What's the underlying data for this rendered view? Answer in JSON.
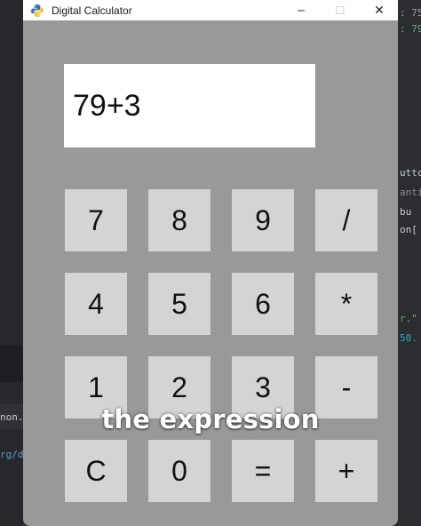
{
  "window": {
    "title": "Digital Calculator",
    "minimize_glyph": "─",
    "maximize_glyph": "☐",
    "close_glyph": "✕",
    "icon": "python-icon"
  },
  "display": {
    "value": "79+3"
  },
  "keypad": {
    "rows": [
      [
        "7",
        "8",
        "9",
        "/"
      ],
      [
        "4",
        "5",
        "6",
        "*"
      ],
      [
        "1",
        "2",
        "3",
        "-"
      ],
      [
        "C",
        "0",
        "=",
        "+"
      ]
    ]
  },
  "caption": {
    "text": "the expression"
  },
  "background_editor": {
    "left_fragments": [
      "non.",
      "rg/d"
    ],
    "right_fragments": [
      ": 75",
      ": 79",
      "uttc",
      "antia",
      " bu",
      "on[",
      "r.\"",
      "50."
    ]
  },
  "colors": {
    "window_bg": "#999999",
    "key_bg": "#d4d4d4",
    "display_bg": "#ffffff",
    "titlebar_bg": "#ffffff"
  }
}
